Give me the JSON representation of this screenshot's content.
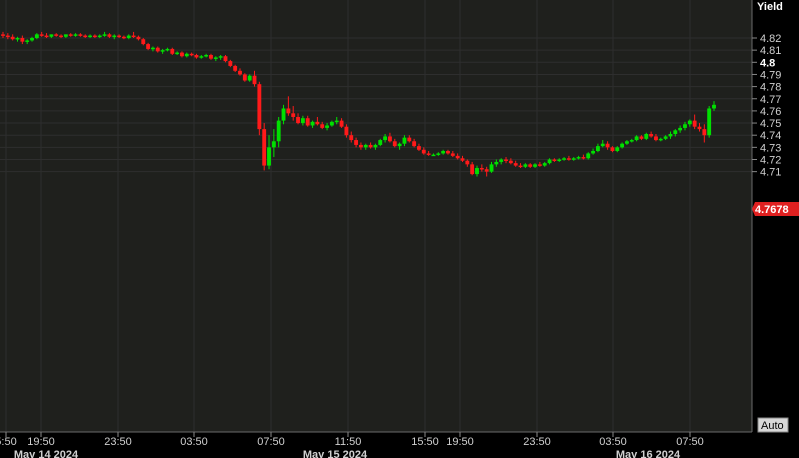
{
  "chart_data": {
    "type": "candlestick",
    "ylabel": "Yield",
    "ylim": [
      4.7,
      4.83
    ],
    "y_ticks": [
      "4.82",
      "4.81",
      "4.8",
      "4.79",
      "4.78",
      "4.77",
      "4.76",
      "4.75",
      "4.74",
      "4.73",
      "4.72",
      "4.71"
    ],
    "y_bold_tick": "4.8",
    "x_ticks": [
      "5:50",
      "19:50",
      "23:50",
      "03:50",
      "07:50",
      "11:50",
      "15:50",
      "19:50",
      "23:50",
      "03:50",
      "07:50"
    ],
    "date_labels": [
      "May 14 2024",
      "May 15 2024",
      "May 16 2024"
    ],
    "last_price": "4.7678",
    "auto_label": "Auto",
    "colors": {
      "up": "#00e000",
      "down": "#ff1a1a",
      "grid": "#2e2e2e",
      "plot_bg": "#1f201d",
      "tag": "#e02020"
    },
    "candles": [
      [
        4.823,
        4.825,
        4.82,
        4.822
      ],
      [
        4.822,
        4.824,
        4.819,
        4.821
      ],
      [
        4.821,
        4.823,
        4.818,
        4.819
      ],
      [
        4.819,
        4.821,
        4.817,
        4.82
      ],
      [
        4.82,
        4.822,
        4.815,
        4.817
      ],
      [
        4.817,
        4.819,
        4.815,
        4.818
      ],
      [
        4.818,
        4.821,
        4.817,
        4.82
      ],
      [
        4.82,
        4.824,
        4.819,
        4.823
      ],
      [
        4.823,
        4.825,
        4.821,
        4.822
      ],
      [
        4.822,
        4.824,
        4.82,
        4.821
      ],
      [
        4.821,
        4.823,
        4.82,
        4.823
      ],
      [
        4.823,
        4.824,
        4.821,
        4.822
      ],
      [
        4.822,
        4.823,
        4.82,
        4.821
      ],
      [
        4.821,
        4.823,
        4.82,
        4.823
      ],
      [
        4.823,
        4.824,
        4.821,
        4.822
      ],
      [
        4.822,
        4.824,
        4.821,
        4.823
      ],
      [
        4.823,
        4.824,
        4.821,
        4.822
      ],
      [
        4.822,
        4.823,
        4.82,
        4.821
      ],
      [
        4.821,
        4.823,
        4.82,
        4.822
      ],
      [
        4.822,
        4.823,
        4.82,
        4.821
      ],
      [
        4.821,
        4.823,
        4.82,
        4.822
      ],
      [
        4.822,
        4.825,
        4.821,
        4.823
      ],
      [
        4.823,
        4.824,
        4.82,
        4.821
      ],
      [
        4.821,
        4.823,
        4.819,
        4.822
      ],
      [
        4.822,
        4.823,
        4.82,
        4.821
      ],
      [
        4.821,
        4.822,
        4.819,
        4.82
      ],
      [
        4.82,
        4.823,
        4.819,
        4.822
      ],
      [
        4.822,
        4.825,
        4.82,
        4.821
      ],
      [
        4.821,
        4.822,
        4.818,
        4.819
      ],
      [
        4.819,
        4.82,
        4.814,
        4.815
      ],
      [
        4.815,
        4.816,
        4.81,
        4.811
      ],
      [
        4.811,
        4.813,
        4.809,
        4.812
      ],
      [
        4.812,
        4.813,
        4.808,
        4.809
      ],
      [
        4.809,
        4.811,
        4.807,
        4.81
      ],
      [
        4.81,
        4.812,
        4.809,
        4.811
      ],
      [
        4.811,
        4.812,
        4.806,
        4.807
      ],
      [
        4.807,
        4.809,
        4.806,
        4.808
      ],
      [
        4.808,
        4.809,
        4.804,
        4.805
      ],
      [
        4.805,
        4.808,
        4.804,
        4.807
      ],
      [
        4.807,
        4.808,
        4.805,
        4.806
      ],
      [
        4.806,
        4.807,
        4.803,
        4.804
      ],
      [
        4.804,
        4.806,
        4.803,
        4.805
      ],
      [
        4.805,
        4.807,
        4.804,
        4.806
      ],
      [
        4.806,
        4.807,
        4.802,
        4.803
      ],
      [
        4.803,
        4.805,
        4.801,
        4.804
      ],
      [
        4.804,
        4.806,
        4.802,
        4.805
      ],
      [
        4.805,
        4.806,
        4.8,
        4.801
      ],
      [
        4.801,
        4.802,
        4.796,
        4.797
      ],
      [
        4.797,
        4.798,
        4.792,
        4.793
      ],
      [
        4.793,
        4.795,
        4.789,
        4.79
      ],
      [
        4.79,
        4.791,
        4.784,
        4.785
      ],
      [
        4.785,
        4.79,
        4.784,
        4.789
      ],
      [
        4.789,
        4.793,
        4.78,
        4.782
      ],
      [
        4.782,
        4.784,
        4.74,
        4.745
      ],
      [
        4.745,
        4.75,
        4.711,
        4.715
      ],
      [
        4.715,
        4.74,
        4.712,
        4.73
      ],
      [
        4.73,
        4.745,
        4.722,
        4.735
      ],
      [
        4.735,
        4.755,
        4.73,
        4.752
      ],
      [
        4.752,
        4.765,
        4.749,
        4.762
      ],
      [
        4.762,
        4.772,
        4.756,
        4.758
      ],
      [
        4.758,
        4.764,
        4.752,
        4.755
      ],
      [
        4.755,
        4.758,
        4.749,
        4.75
      ],
      [
        4.75,
        4.756,
        4.748,
        4.754
      ],
      [
        4.754,
        4.756,
        4.747,
        4.748
      ],
      [
        4.748,
        4.752,
        4.746,
        4.751
      ],
      [
        4.751,
        4.755,
        4.748,
        4.749
      ],
      [
        4.749,
        4.751,
        4.745,
        4.746
      ],
      [
        4.746,
        4.75,
        4.744,
        4.748
      ],
      [
        4.748,
        4.752,
        4.747,
        4.751
      ],
      [
        4.751,
        4.755,
        4.749,
        4.752
      ],
      [
        4.752,
        4.754,
        4.746,
        4.747
      ],
      [
        4.747,
        4.749,
        4.738,
        4.74
      ],
      [
        4.74,
        4.743,
        4.734,
        4.736
      ],
      [
        4.736,
        4.738,
        4.73,
        4.732
      ],
      [
        4.732,
        4.734,
        4.728,
        4.73
      ],
      [
        4.73,
        4.733,
        4.728,
        4.732
      ],
      [
        4.732,
        4.734,
        4.729,
        4.73
      ],
      [
        4.73,
        4.733,
        4.728,
        4.732
      ],
      [
        4.732,
        4.737,
        4.731,
        4.736
      ],
      [
        4.736,
        4.741,
        4.734,
        4.739
      ],
      [
        4.739,
        4.742,
        4.734,
        4.735
      ],
      [
        4.735,
        4.737,
        4.73,
        4.731
      ],
      [
        4.731,
        4.734,
        4.728,
        4.733
      ],
      [
        4.733,
        4.74,
        4.731,
        4.738
      ],
      [
        4.738,
        4.74,
        4.734,
        4.735
      ],
      [
        4.735,
        4.737,
        4.73,
        4.731
      ],
      [
        4.731,
        4.733,
        4.727,
        4.728
      ],
      [
        4.728,
        4.73,
        4.724,
        4.725
      ],
      [
        4.725,
        4.727,
        4.723,
        4.724
      ],
      [
        4.724,
        4.725,
        4.723,
        4.724
      ],
      [
        4.724,
        4.726,
        4.723,
        4.725
      ],
      [
        4.725,
        4.728,
        4.724,
        4.727
      ],
      [
        4.727,
        4.728,
        4.724,
        4.725
      ],
      [
        4.725,
        4.727,
        4.722,
        4.723
      ],
      [
        4.723,
        4.725,
        4.72,
        4.721
      ],
      [
        4.721,
        4.723,
        4.718,
        4.719
      ],
      [
        4.719,
        4.72,
        4.714,
        4.716
      ],
      [
        4.716,
        4.718,
        4.707,
        4.708
      ],
      [
        4.708,
        4.715,
        4.706,
        4.713
      ],
      [
        4.713,
        4.716,
        4.71,
        4.712
      ],
      [
        4.712,
        4.714,
        4.706,
        4.71
      ],
      [
        4.71,
        4.718,
        4.709,
        4.716
      ],
      [
        4.716,
        4.72,
        4.714,
        4.718
      ],
      [
        4.718,
        4.721,
        4.716,
        4.72
      ],
      [
        4.72,
        4.722,
        4.717,
        4.719
      ],
      [
        4.719,
        4.721,
        4.716,
        4.717
      ],
      [
        4.717,
        4.719,
        4.714,
        4.715
      ],
      [
        4.715,
        4.717,
        4.713,
        4.714
      ],
      [
        4.714,
        4.717,
        4.713,
        4.716
      ],
      [
        4.716,
        4.717,
        4.713,
        4.714
      ],
      [
        4.714,
        4.717,
        4.713,
        4.716
      ],
      [
        4.716,
        4.718,
        4.714,
        4.715
      ],
      [
        4.715,
        4.718,
        4.714,
        4.717
      ],
      [
        4.717,
        4.721,
        4.716,
        4.72
      ],
      [
        4.72,
        4.721,
        4.718,
        4.719
      ],
      [
        4.719,
        4.721,
        4.718,
        4.72
      ],
      [
        4.72,
        4.722,
        4.719,
        4.721
      ],
      [
        4.721,
        4.723,
        4.719,
        4.72
      ],
      [
        4.72,
        4.722,
        4.719,
        4.721
      ],
      [
        4.721,
        4.723,
        4.72,
        4.722
      ],
      [
        4.722,
        4.724,
        4.72,
        4.721
      ],
      [
        4.721,
        4.726,
        4.72,
        4.725
      ],
      [
        4.725,
        4.729,
        4.724,
        4.727
      ],
      [
        4.727,
        4.733,
        4.726,
        4.731
      ],
      [
        4.731,
        4.736,
        4.73,
        4.733
      ],
      [
        4.733,
        4.735,
        4.728,
        4.73
      ],
      [
        4.73,
        4.731,
        4.726,
        4.727
      ],
      [
        4.727,
        4.731,
        4.726,
        4.73
      ],
      [
        4.73,
        4.734,
        4.729,
        4.733
      ],
      [
        4.733,
        4.736,
        4.732,
        4.735
      ],
      [
        4.735,
        4.737,
        4.734,
        4.736
      ],
      [
        4.736,
        4.74,
        4.735,
        4.739
      ],
      [
        4.739,
        4.74,
        4.736,
        4.737
      ],
      [
        4.737,
        4.742,
        4.736,
        4.741
      ],
      [
        4.741,
        4.743,
        4.738,
        4.739
      ],
      [
        4.739,
        4.741,
        4.735,
        4.736
      ],
      [
        4.736,
        4.738,
        4.735,
        4.737
      ],
      [
        4.737,
        4.74,
        4.736,
        4.739
      ],
      [
        4.739,
        4.743,
        4.737,
        4.741
      ],
      [
        4.741,
        4.745,
        4.739,
        4.744
      ],
      [
        4.744,
        4.748,
        4.742,
        4.746
      ],
      [
        4.746,
        4.751,
        4.744,
        4.749
      ],
      [
        4.749,
        4.753,
        4.747,
        4.752
      ],
      [
        4.752,
        4.757,
        4.745,
        4.747
      ],
      [
        4.747,
        4.75,
        4.743,
        4.745
      ],
      [
        4.745,
        4.749,
        4.734,
        4.74
      ],
      [
        4.74,
        4.764,
        4.738,
        4.762
      ],
      [
        4.762,
        4.768,
        4.76,
        4.765
      ]
    ]
  }
}
